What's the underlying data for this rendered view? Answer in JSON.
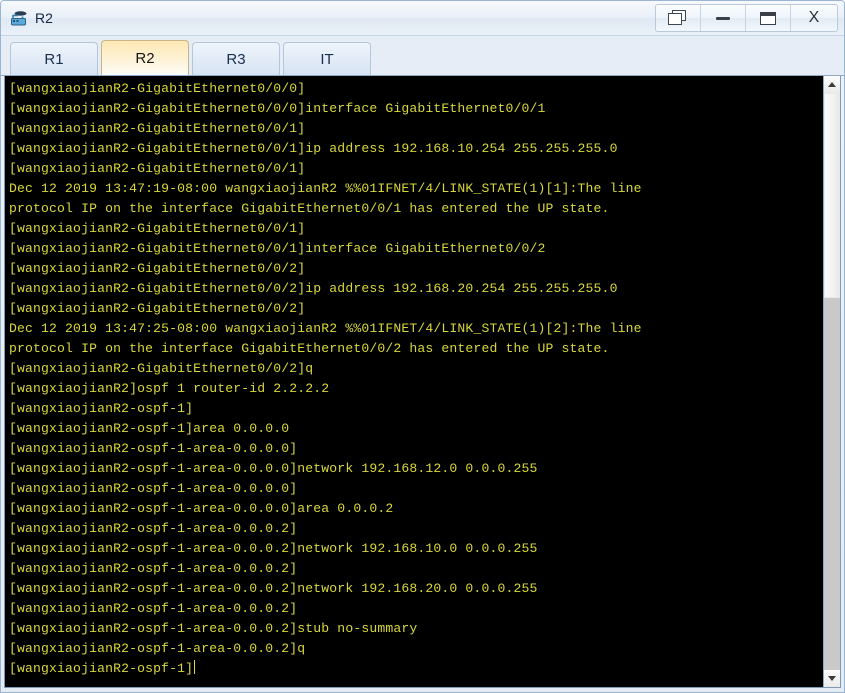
{
  "window": {
    "title": "R2",
    "app_icon": "router-icon",
    "controls": [
      {
        "name": "restore-button",
        "icon": "restore-icon",
        "label": ""
      },
      {
        "name": "minimize-button",
        "icon": "minimize-icon",
        "label": ""
      },
      {
        "name": "maximize-button",
        "icon": "maximize-icon",
        "label": ""
      },
      {
        "name": "close-button",
        "icon": "close-icon",
        "label": "X"
      }
    ]
  },
  "tabs": [
    {
      "label": "R1",
      "active": false
    },
    {
      "label": "R2",
      "active": true
    },
    {
      "label": "R3",
      "active": false
    },
    {
      "label": "IT",
      "active": false
    }
  ],
  "terminal": {
    "text_color": "#d8d83c",
    "background_color": "#000000",
    "lines": [
      "[wangxiaojianR2-GigabitEthernet0/0/0]",
      "[wangxiaojianR2-GigabitEthernet0/0/0]interface GigabitEthernet0/0/1",
      "[wangxiaojianR2-GigabitEthernet0/0/1]",
      "[wangxiaojianR2-GigabitEthernet0/0/1]ip address 192.168.10.254 255.255.255.0",
      "[wangxiaojianR2-GigabitEthernet0/0/1]",
      "Dec 12 2019 13:47:19-08:00 wangxiaojianR2 %%01IFNET/4/LINK_STATE(1)[1]:The line",
      "protocol IP on the interface GigabitEthernet0/0/1 has entered the UP state.",
      "[wangxiaojianR2-GigabitEthernet0/0/1]",
      "[wangxiaojianR2-GigabitEthernet0/0/1]interface GigabitEthernet0/0/2",
      "[wangxiaojianR2-GigabitEthernet0/0/2]",
      "[wangxiaojianR2-GigabitEthernet0/0/2]ip address 192.168.20.254 255.255.255.0",
      "[wangxiaojianR2-GigabitEthernet0/0/2]",
      "Dec 12 2019 13:47:25-08:00 wangxiaojianR2 %%01IFNET/4/LINK_STATE(1)[2]:The line",
      "protocol IP on the interface GigabitEthernet0/0/2 has entered the UP state.",
      "[wangxiaojianR2-GigabitEthernet0/0/2]q",
      "[wangxiaojianR2]ospf 1 router-id 2.2.2.2",
      "[wangxiaojianR2-ospf-1]",
      "[wangxiaojianR2-ospf-1]area 0.0.0.0",
      "[wangxiaojianR2-ospf-1-area-0.0.0.0]",
      "[wangxiaojianR2-ospf-1-area-0.0.0.0]network 192.168.12.0 0.0.0.255",
      "[wangxiaojianR2-ospf-1-area-0.0.0.0]",
      "[wangxiaojianR2-ospf-1-area-0.0.0.0]area 0.0.0.2",
      "[wangxiaojianR2-ospf-1-area-0.0.0.2]",
      "[wangxiaojianR2-ospf-1-area-0.0.0.2]network 192.168.10.0 0.0.0.255",
      "[wangxiaojianR2-ospf-1-area-0.0.0.2]",
      "[wangxiaojianR2-ospf-1-area-0.0.0.2]network 192.168.20.0 0.0.0.255",
      "[wangxiaojianR2-ospf-1-area-0.0.0.2]",
      "[wangxiaojianR2-ospf-1-area-0.0.0.2]stub no-summary",
      "[wangxiaojianR2-ospf-1-area-0.0.0.2]q",
      "[wangxiaojianR2-ospf-1]"
    ],
    "prompt_line_has_cursor": true
  },
  "scrollbar": {
    "up_icon": "chevron-up-icon",
    "down_icon": "chevron-down-icon",
    "thumb_position_percent": 0
  }
}
